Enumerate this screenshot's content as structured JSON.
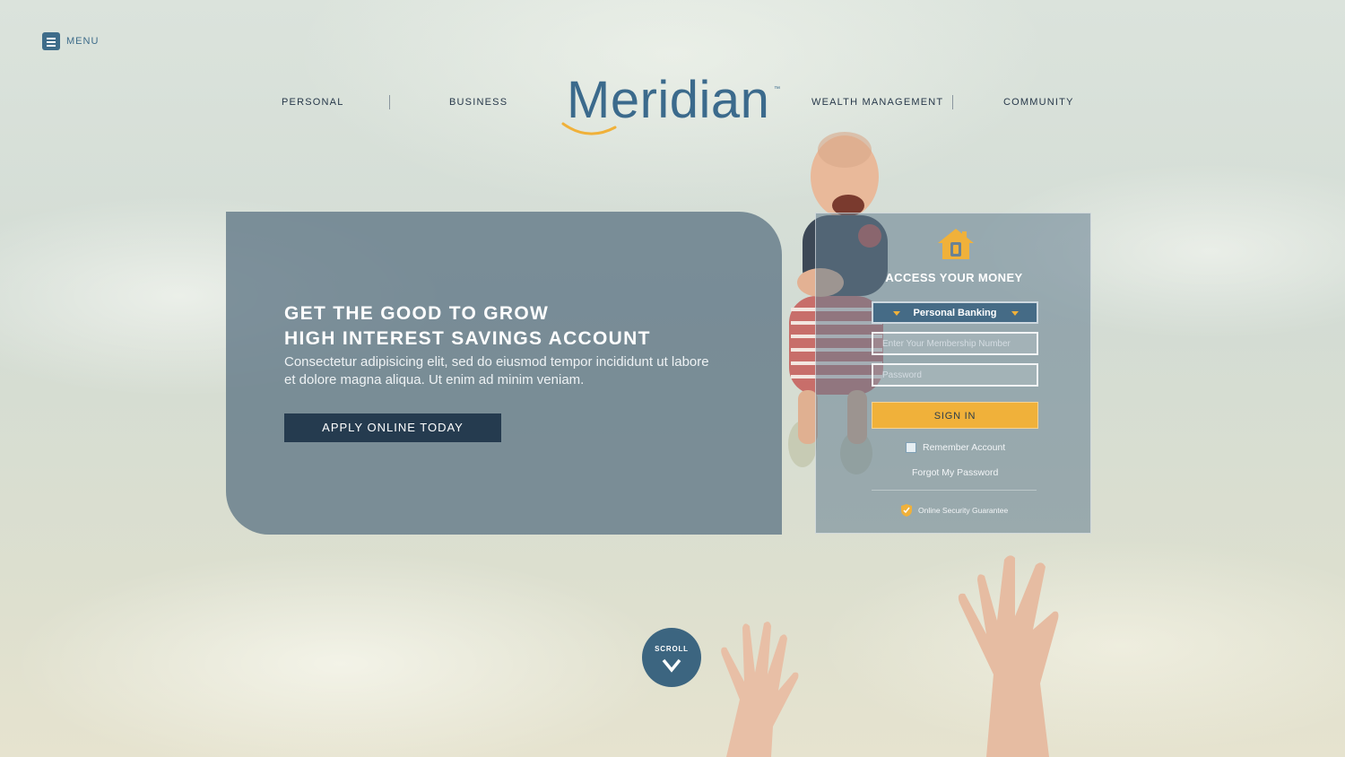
{
  "header": {
    "menu_label": "MENU",
    "logo_text": "Meridian",
    "logo_tm": "™",
    "nav": [
      "PERSONAL",
      "BUSINESS",
      "WEALTH MANAGEMENT",
      "COMMUNITY"
    ]
  },
  "hero": {
    "headline_line1": "GET THE GOOD TO GROW",
    "headline_line2": "HIGH INTEREST SAVINGS ACCOUNT",
    "body": "Consectetur adipisicing elit, sed do eiusmod tempor incididunt ut labore et dolore magna aliqua. Ut enim ad minim veniam.",
    "cta_label": "APPLY ONLINE TODAY"
  },
  "login": {
    "title": "ACCESS YOUR MONEY",
    "banking_type": "Personal Banking",
    "membership_placeholder": "Enter Your Membership Number",
    "password_placeholder": "Password",
    "signin_label": "SIGN IN",
    "remember_label": "Remember Account",
    "forgot_label": "Forgot My Password",
    "security_label": "Online Security Guarantee"
  },
  "scroll": {
    "label": "SCROLL"
  },
  "colors": {
    "brand_blue": "#3b6a8c",
    "accent_gold": "#f0b13a",
    "dark_navy": "#253b4f"
  }
}
